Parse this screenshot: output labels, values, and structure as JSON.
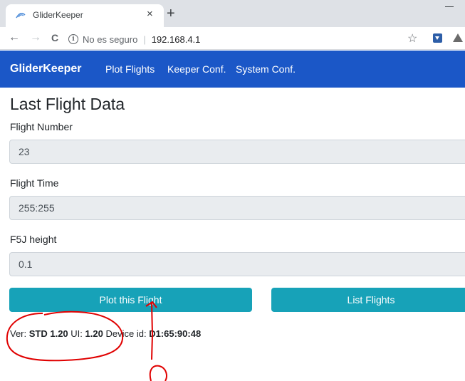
{
  "browser": {
    "tab_title": "GliderKeeper",
    "tab_close": "×",
    "new_tab": "+",
    "back": "←",
    "forward": "→",
    "reload": "C",
    "info_glyph": "i",
    "security_text": "No es seguro",
    "separator": "|",
    "url": "192.168.4.1",
    "star": "☆"
  },
  "navbar": {
    "brand": "GliderKeeper",
    "links": [
      "Plot Flights",
      "Keeper Conf.",
      "System Conf."
    ],
    "color": "#1b57c7"
  },
  "main": {
    "title": "Last Flight Data",
    "fields": [
      {
        "label": "Flight Number",
        "value": "23"
      },
      {
        "label": "Flight Time",
        "value": "255:255"
      },
      {
        "label": "F5J height",
        "value": "0.1"
      }
    ],
    "buttons": {
      "plot": "Plot this Flight",
      "list": "List Flights",
      "color": "#17a2b8"
    },
    "version": {
      "ver_label": "Ver:",
      "ver_value": "STD 1.20",
      "ui_label": "UI:",
      "ui_value": "1.20",
      "device_label": "Device id:",
      "device_value": "D1:65:90:48"
    }
  },
  "annotation_color": "#e00000"
}
